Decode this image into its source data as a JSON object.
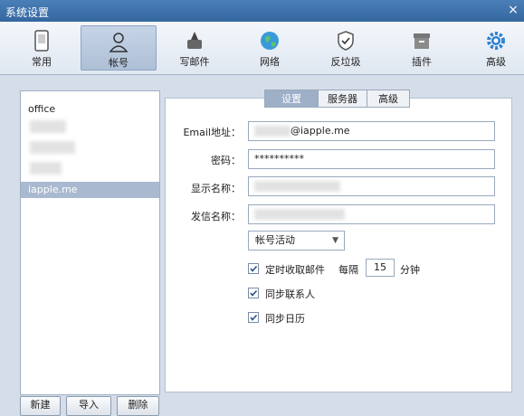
{
  "window": {
    "title": "系统设置",
    "close": "×"
  },
  "toolbar": {
    "items": [
      {
        "label": "常用",
        "icon": "phone-icon"
      },
      {
        "label": "帐号",
        "icon": "user-icon",
        "selected": true
      },
      {
        "label": "写邮件",
        "icon": "write-mail-icon"
      },
      {
        "label": "网络",
        "icon": "globe-icon"
      },
      {
        "label": "反垃圾",
        "icon": "shield-icon"
      },
      {
        "label": "插件",
        "icon": "plugin-box-icon"
      },
      {
        "label": "高级",
        "icon": "gear-icon"
      }
    ]
  },
  "accounts": {
    "items": [
      {
        "label": "office"
      },
      {
        "label": "iapple.me",
        "selected": true
      }
    ]
  },
  "bottom_buttons": {
    "new": "新建",
    "import": "导入",
    "delete": "删除"
  },
  "tabs": [
    {
      "label": "设置",
      "selected": true
    },
    {
      "label": "服务器"
    },
    {
      "label": "高级"
    }
  ],
  "form": {
    "email_label": "Email地址：",
    "email_value": "@iapple.me",
    "password_label": "密码：",
    "password_value": "**********",
    "display_name_label": "显示名称：",
    "display_name_value": "",
    "sender_name_label": "发信名称：",
    "sender_name_value": "",
    "status_select": "帐号活动",
    "timed_fetch_label": "定时收取邮件",
    "every_label": "每隔",
    "every_value": "15",
    "minutes_label": "分钟",
    "sync_contacts_label": "同步联系人",
    "sync_calendar_label": "同步日历"
  },
  "colors": {
    "titlebar": "#35679f",
    "selected": "#a9b9cf"
  }
}
